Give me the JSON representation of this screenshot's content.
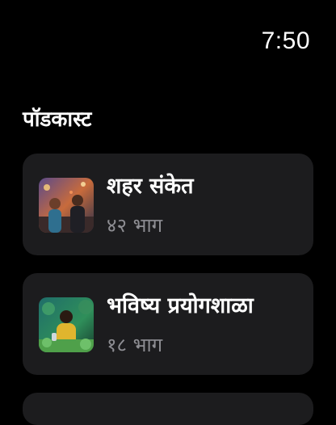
{
  "status_bar": {
    "time": "7:50"
  },
  "header": {
    "title": "पॉडकास्ट"
  },
  "podcasts": [
    {
      "title": "शहर संकेत",
      "episodes": "४२ भाग",
      "artwork_icon": "city-couple-artwork"
    },
    {
      "title": "भविष्य प्रयोगशाळा",
      "episodes": "१८ भाग",
      "artwork_icon": "lab-woman-artwork"
    }
  ],
  "colors": {
    "background": "#000000",
    "card": "#1c1c1e",
    "subtitle": "#8e8e93",
    "text": "#ffffff"
  }
}
